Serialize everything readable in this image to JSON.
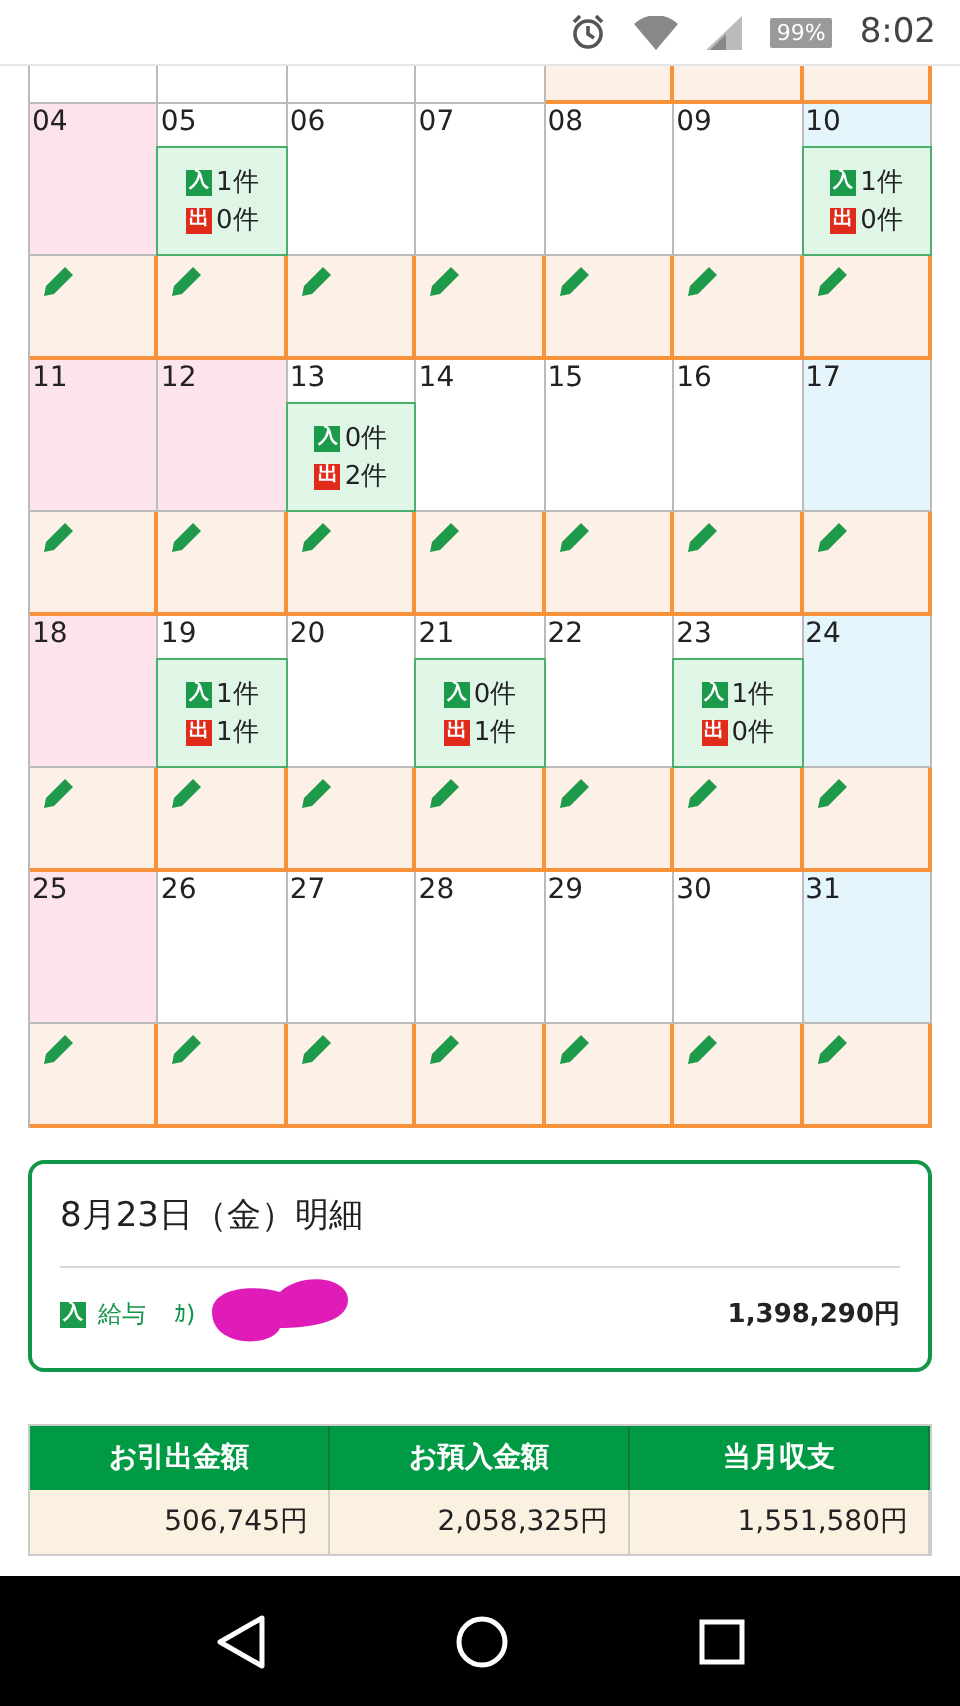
{
  "status_bar": {
    "battery": "99%",
    "time": "8:02"
  },
  "calendar": {
    "tail_row": [
      {
        "in_month": false
      },
      {
        "in_month": false
      },
      {
        "in_month": false
      },
      {
        "in_month": false
      },
      {
        "in_month": true
      },
      {
        "in_month": true
      },
      {
        "in_month": true
      }
    ],
    "weeks": [
      {
        "days": [
          {
            "date": "04",
            "kind": "sunday"
          },
          {
            "date": "05",
            "kind": "weekday",
            "in_label": "入",
            "in": "1件",
            "out_label": "出",
            "out": "0件"
          },
          {
            "date": "06",
            "kind": "weekday"
          },
          {
            "date": "07",
            "kind": "weekday"
          },
          {
            "date": "08",
            "kind": "weekday"
          },
          {
            "date": "09",
            "kind": "weekday"
          },
          {
            "date": "10",
            "kind": "saturday",
            "in_label": "入",
            "in": "1件",
            "out_label": "出",
            "out": "0件"
          }
        ]
      },
      {
        "days": [
          {
            "date": "11",
            "kind": "sunday"
          },
          {
            "date": "12",
            "kind": "sunday"
          },
          {
            "date": "13",
            "kind": "weekday",
            "in_label": "入",
            "in": "0件",
            "out_label": "出",
            "out": "2件"
          },
          {
            "date": "14",
            "kind": "weekday"
          },
          {
            "date": "15",
            "kind": "weekday"
          },
          {
            "date": "16",
            "kind": "weekday"
          },
          {
            "date": "17",
            "kind": "saturday"
          }
        ]
      },
      {
        "days": [
          {
            "date": "18",
            "kind": "sunday"
          },
          {
            "date": "19",
            "kind": "weekday",
            "in_label": "入",
            "in": "1件",
            "out_label": "出",
            "out": "1件"
          },
          {
            "date": "20",
            "kind": "weekday"
          },
          {
            "date": "21",
            "kind": "weekday",
            "in_label": "入",
            "in": "0件",
            "out_label": "出",
            "out": "1件"
          },
          {
            "date": "22",
            "kind": "weekday"
          },
          {
            "date": "23",
            "kind": "weekday",
            "in_label": "入",
            "in": "1件",
            "out_label": "出",
            "out": "0件"
          },
          {
            "date": "24",
            "kind": "saturday"
          }
        ]
      },
      {
        "days": [
          {
            "date": "25",
            "kind": "sunday"
          },
          {
            "date": "26",
            "kind": "weekday"
          },
          {
            "date": "27",
            "kind": "weekday"
          },
          {
            "date": "28",
            "kind": "weekday"
          },
          {
            "date": "29",
            "kind": "weekday"
          },
          {
            "date": "30",
            "kind": "weekday"
          },
          {
            "date": "31",
            "kind": "saturday"
          }
        ]
      }
    ]
  },
  "detail": {
    "title": "8月23日（金）明細",
    "entries": [
      {
        "badge": "入",
        "category": "給与",
        "payee": "ｶ)",
        "redacted": true,
        "amount": "1,398,290円"
      }
    ]
  },
  "summary": {
    "columns": [
      "お引出金額",
      "お預入金額",
      "当月収支"
    ],
    "values": [
      "506,745円",
      "2,058,325円",
      "1,551,580円"
    ]
  }
}
